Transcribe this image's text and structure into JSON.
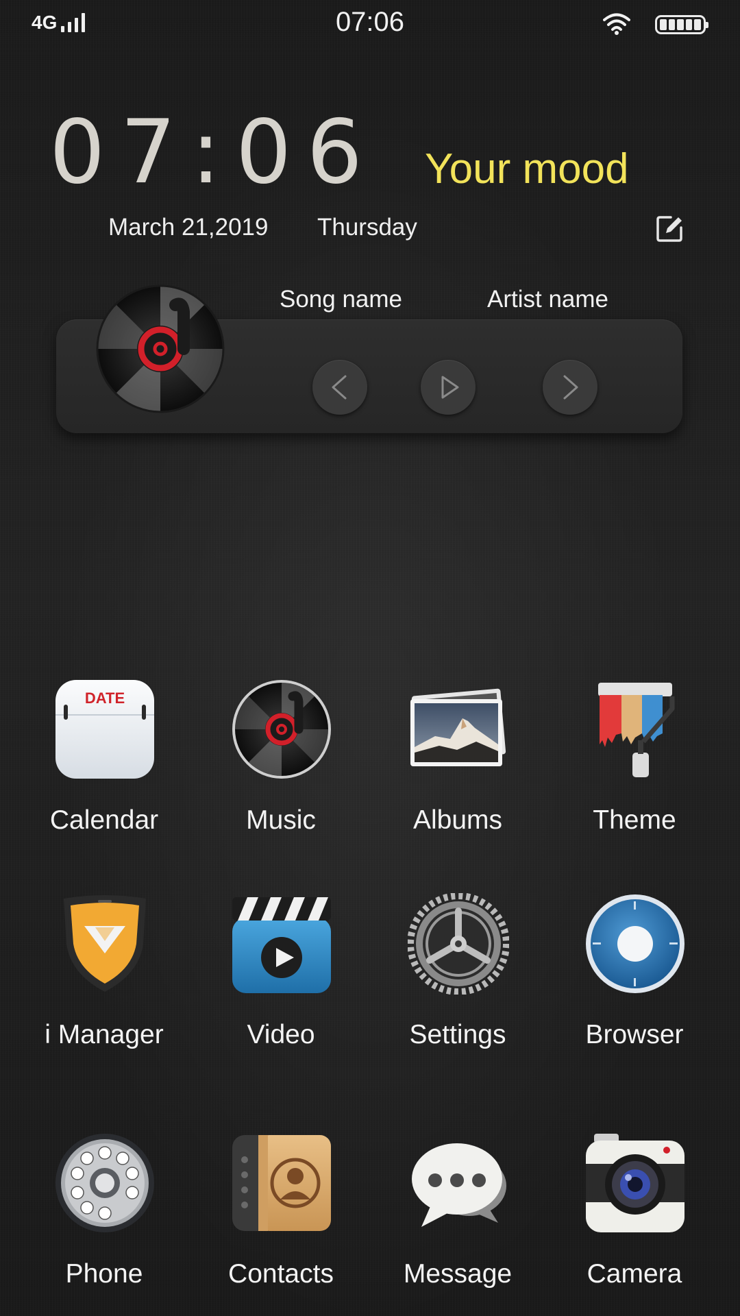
{
  "status_bar": {
    "network": "4G",
    "time": "07:06"
  },
  "clock_widget": {
    "time": "07:06",
    "mood": "Your mood",
    "date": "March 21,2019",
    "weekday": "Thursday"
  },
  "music_widget": {
    "song_name": "Song name",
    "artist_name": "Artist name"
  },
  "apps": [
    {
      "label": "Calendar",
      "icon": "calendar-icon",
      "icon_text": "DATE"
    },
    {
      "label": "Music",
      "icon": "music-icon"
    },
    {
      "label": "Albums",
      "icon": "albums-icon"
    },
    {
      "label": "Theme",
      "icon": "theme-icon"
    },
    {
      "label": "i Manager",
      "icon": "shield-icon"
    },
    {
      "label": "Video",
      "icon": "video-icon"
    },
    {
      "label": "Settings",
      "icon": "gear-icon"
    },
    {
      "label": "Browser",
      "icon": "compass-icon"
    },
    {
      "label": "Phone",
      "icon": "phone-dial-icon"
    },
    {
      "label": "Contacts",
      "icon": "contacts-book-icon"
    },
    {
      "label": "Message",
      "icon": "chat-bubble-icon"
    },
    {
      "label": "Camera",
      "icon": "camera-icon"
    }
  ],
  "colors": {
    "mood_accent": "#f2e35a",
    "clock_digits": "#d6d3cc",
    "record_red": "#d2202a"
  }
}
